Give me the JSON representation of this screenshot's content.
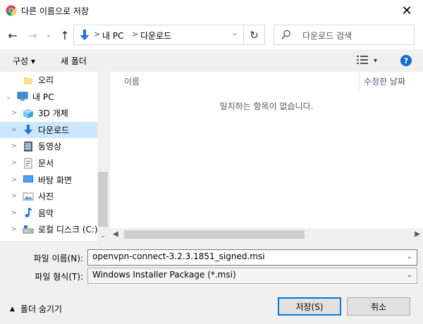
{
  "window": {
    "title": "다른 이름으로 저장",
    "close_glyph": "✕"
  },
  "nav": {
    "back_glyph": "←",
    "forward_glyph": "→",
    "recent_glyph": "⌄",
    "up_glyph": "↑",
    "breadcrumb_sep": ">",
    "breadcrumbs": [
      "내 PC",
      "다운로드"
    ],
    "refresh_glyph": "↻",
    "search_placeholder": "다운로드 검색"
  },
  "toolbar": {
    "organize_label": "구성 ▾",
    "new_folder_label": "새 폴더",
    "view_dd_glyph": "▾",
    "help_label": "?"
  },
  "tree": {
    "items": [
      {
        "label": "오리",
        "icon": "folder-icon",
        "chevron": "",
        "indent": 1,
        "selected": false
      },
      {
        "label": "내 PC",
        "icon": "pc-icon",
        "chevron": "⌄",
        "indent": 0,
        "selected": false
      },
      {
        "label": "3D 개체",
        "icon": "3d-objects-icon",
        "chevron": ">",
        "indent": 1,
        "selected": false
      },
      {
        "label": "다운로드",
        "icon": "downloads-icon",
        "chevron": ">",
        "indent": 1,
        "selected": true
      },
      {
        "label": "동영상",
        "icon": "videos-icon",
        "chevron": ">",
        "indent": 1,
        "selected": false
      },
      {
        "label": "문서",
        "icon": "documents-icon",
        "chevron": ">",
        "indent": 1,
        "selected": false
      },
      {
        "label": "바탕 화면",
        "icon": "desktop-icon",
        "chevron": ">",
        "indent": 1,
        "selected": false
      },
      {
        "label": "사진",
        "icon": "pictures-icon",
        "chevron": ">",
        "indent": 1,
        "selected": false
      },
      {
        "label": "음악",
        "icon": "music-icon",
        "chevron": ">",
        "indent": 1,
        "selected": false
      },
      {
        "label": "로컬 디스크 (C:)",
        "icon": "local-disk-icon",
        "chevron": ">",
        "indent": 1,
        "selected": false
      }
    ]
  },
  "content": {
    "col_name": "이름",
    "col_date": "수정한 날짜",
    "empty_message": "일치하는 항목이 없습니다."
  },
  "form": {
    "filename_label": "파일 이름(N):",
    "filename_value": "openvpn-connect-3.2.3.1851_signed.msi",
    "filetype_label": "파일 형식(T):",
    "filetype_value": "Windows Installer Package (*.msi)",
    "dropdown_glyph": "⌄",
    "hide_folders_glyph": "▲",
    "hide_folders_label": "폴더 숨기기",
    "save_label": "저장(S)",
    "cancel_label": "취소"
  },
  "colors": {
    "accent": "#0078d7",
    "selection": "#cce8ff",
    "help": "#1a6ec9"
  }
}
